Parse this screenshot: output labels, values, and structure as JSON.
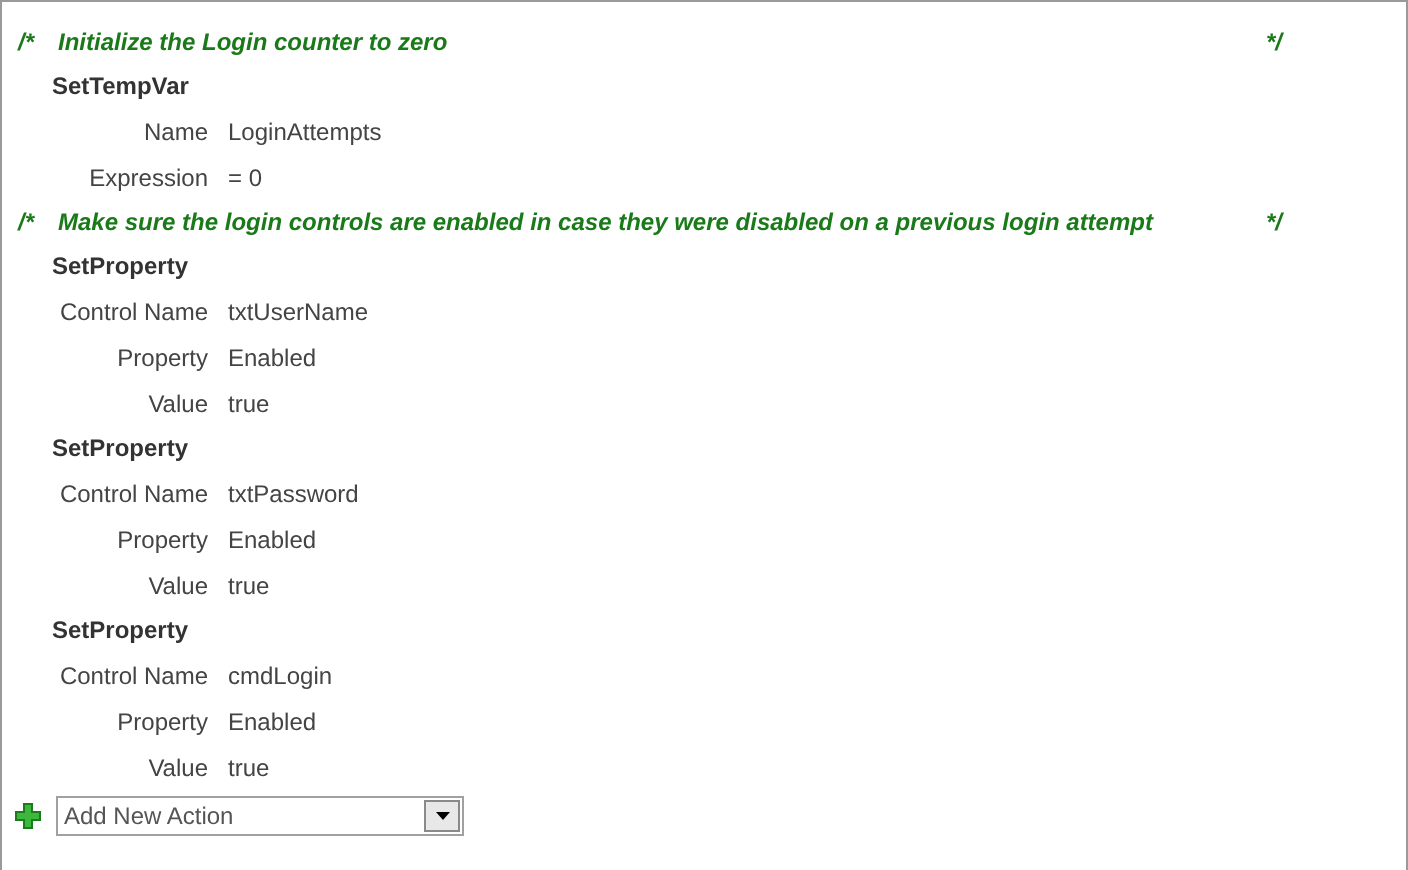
{
  "macro": [
    {
      "kind": "comment",
      "open": "/*",
      "text": "Initialize the Login counter to zero",
      "close": "*/"
    },
    {
      "kind": "action",
      "name": "SetTempVar",
      "args": [
        {
          "label": "Name",
          "value": "LoginAttempts"
        },
        {
          "label": "Expression",
          "value": "= 0"
        }
      ]
    },
    {
      "kind": "comment",
      "open": "/*",
      "text": "Make sure the login controls are enabled in case they were disabled on a previous login attempt",
      "close": "*/"
    },
    {
      "kind": "action",
      "name": "SetProperty",
      "args": [
        {
          "label": "Control Name",
          "value": "txtUserName"
        },
        {
          "label": "Property",
          "value": "Enabled"
        },
        {
          "label": "Value",
          "value": "true"
        }
      ]
    },
    {
      "kind": "action",
      "name": "SetProperty",
      "args": [
        {
          "label": "Control Name",
          "value": "txtPassword"
        },
        {
          "label": "Property",
          "value": "Enabled"
        },
        {
          "label": "Value",
          "value": "true"
        }
      ]
    },
    {
      "kind": "action",
      "name": "SetProperty",
      "args": [
        {
          "label": "Control Name",
          "value": "cmdLogin"
        },
        {
          "label": "Property",
          "value": "Enabled"
        },
        {
          "label": "Value",
          "value": "true"
        }
      ]
    }
  ],
  "add_action": {
    "placeholder": "Add New Action"
  }
}
